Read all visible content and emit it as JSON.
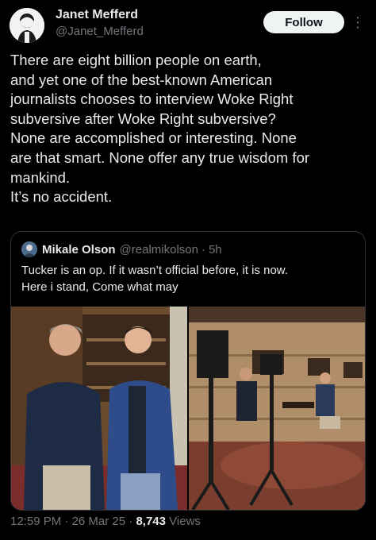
{
  "author": {
    "name": "Janet Mefferd",
    "handle": "@Janet_Mefferd",
    "avatar_icon": "avatar-illustration-icon"
  },
  "follow_label": "Follow",
  "more_icon": "more-options-icon",
  "tweet_lines": [
    "There are eight billion people on earth,",
    "and yet one of the best-known American",
    "journalists chooses to interview Woke Right",
    "subversive after Woke Right subversive?",
    "None are accomplished or interesting. None",
    "are that smart. None offer any true wisdom for",
    "mankind.",
    "It’s no accident."
  ],
  "quote": {
    "name": "Mikale Olson",
    "handle": "@realmikolson",
    "separator": "·",
    "time": "5h",
    "lines": [
      "Tucker is an op. If it wasn’t official before, it is now.",
      "Here i stand, Come what may"
    ]
  },
  "footer": {
    "time": "12:59 PM",
    "sep1": " · ",
    "date": "26 Mar 25",
    "sep2": " · ",
    "views_count": "8,743",
    "views_label": " Views"
  },
  "colors": {
    "background": "#000000",
    "text": "#e7e9ea",
    "secondary": "#71767b",
    "border": "#2f3336",
    "follow_bg": "#eff3f4"
  }
}
